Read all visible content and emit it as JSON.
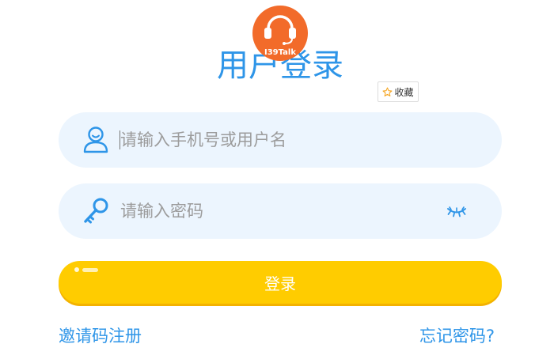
{
  "logo": {
    "text": "I39Talk",
    "icon": "headphones-icon"
  },
  "title": "用户登录",
  "favorite": {
    "icon": "star-outline-icon",
    "label": "收藏"
  },
  "username": {
    "icon": "user-icon",
    "placeholder": "请输入手机号或用户名",
    "value": ""
  },
  "password": {
    "icon": "key-icon",
    "placeholder": "请输入密码",
    "value": "",
    "toggle_icon": "eye-closed-icon"
  },
  "login_button": {
    "label": "登录"
  },
  "links": {
    "register": "邀请码注册",
    "forgot_password": "忘记密码?"
  },
  "colors": {
    "primary": "#2E95E8",
    "logo": "#F26B2A",
    "input_background": "#ECF5FE",
    "placeholder": "#9C9C9C",
    "button": "#FFCC00",
    "button_shadow": "#F3B200",
    "star": "#F5A623"
  }
}
